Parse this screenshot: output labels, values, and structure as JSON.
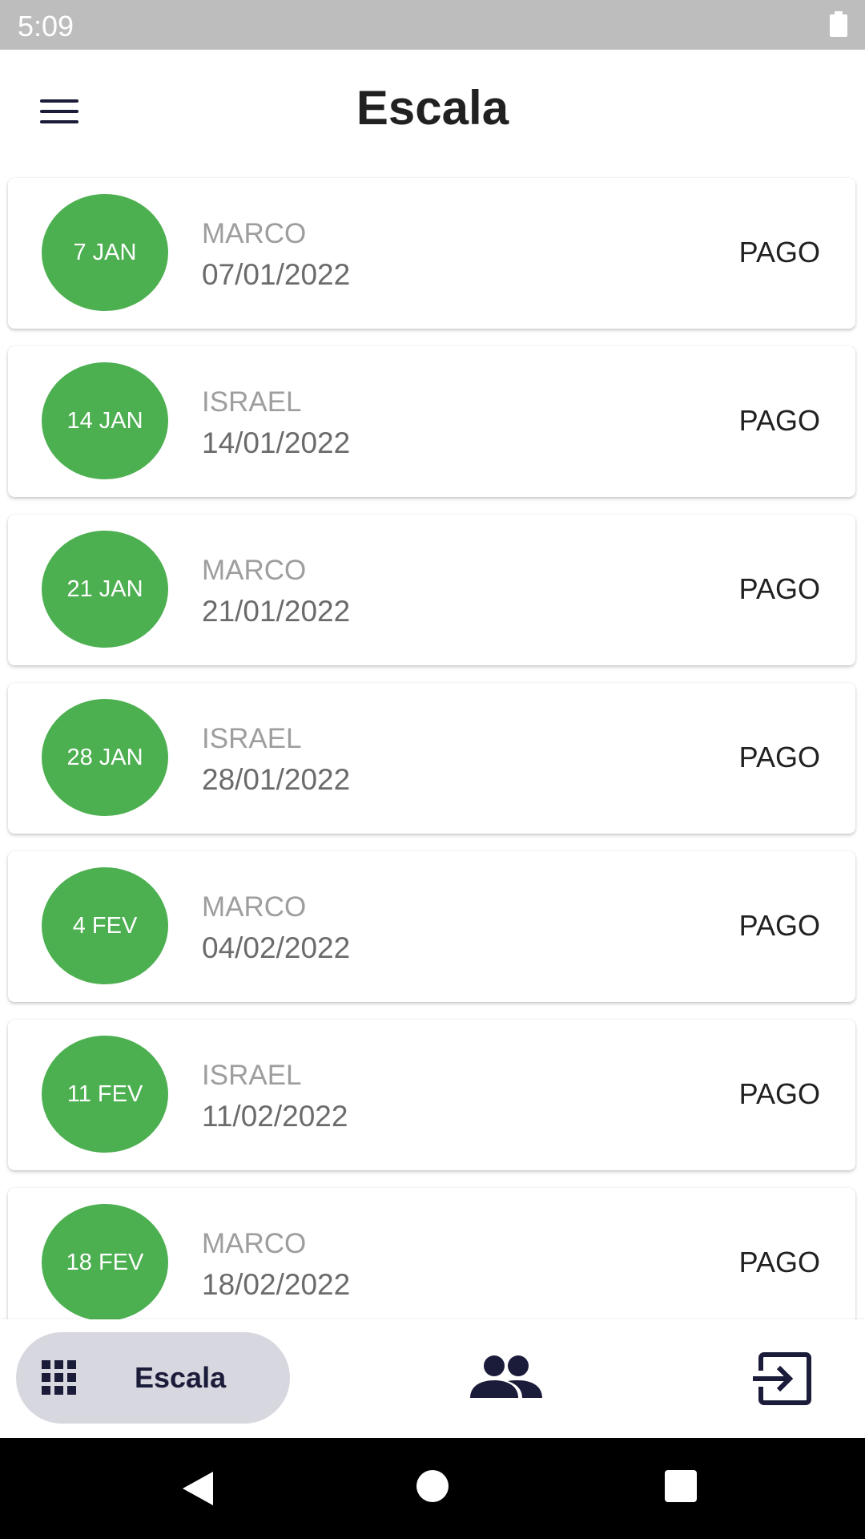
{
  "status_bar": {
    "time": "5:09",
    "battery_icon": "battery-full-icon"
  },
  "app_bar": {
    "title": "Escala",
    "menu_icon": "menu-icon"
  },
  "items": [
    {
      "badge": "7 JAN",
      "name": "MARCO",
      "date": "07/01/2022",
      "status": "PAGO"
    },
    {
      "badge": "14 JAN",
      "name": "ISRAEL",
      "date": "14/01/2022",
      "status": "PAGO"
    },
    {
      "badge": "21 JAN",
      "name": "MARCO",
      "date": "21/01/2022",
      "status": "PAGO"
    },
    {
      "badge": "28 JAN",
      "name": "ISRAEL",
      "date": "28/01/2022",
      "status": "PAGO"
    },
    {
      "badge": "4 FEV",
      "name": "MARCO",
      "date": "04/02/2022",
      "status": "PAGO"
    },
    {
      "badge": "11 FEV",
      "name": "ISRAEL",
      "date": "11/02/2022",
      "status": "PAGO"
    },
    {
      "badge": "18 FEV",
      "name": "MARCO",
      "date": "18/02/2022",
      "status": "PAGO"
    }
  ],
  "bottom_nav": {
    "active_label": "Escala",
    "active_icon": "apps-grid-icon",
    "people_icon": "people-icon",
    "exit_icon": "exit-icon"
  },
  "colors": {
    "badge": "#4caf50",
    "accent": "#1b1b3a",
    "active_pill": "#d7d7df",
    "status_bar": "#bdbdbd"
  }
}
